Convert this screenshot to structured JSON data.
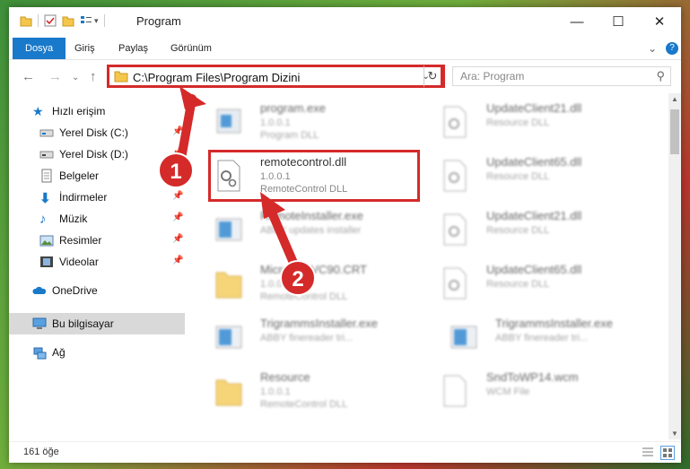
{
  "window": {
    "title": "Program",
    "minimize_icon": "minimize-icon",
    "maximize_icon": "maximize-icon",
    "close_icon": "close-icon"
  },
  "ribbon": {
    "tabs": [
      {
        "label": "Dosya",
        "active": true
      },
      {
        "label": "Giriş"
      },
      {
        "label": "Paylaş"
      },
      {
        "label": "Görünüm"
      }
    ],
    "help_icon": "help-icon"
  },
  "address_bar": {
    "path": "C:\\Program Files\\Program Dizini",
    "refresh_icon": "refresh-icon"
  },
  "search": {
    "placeholder": "Ara: Program"
  },
  "nav_pane": {
    "items": [
      {
        "label": "Hızlı erişim",
        "icon": "star-icon"
      },
      {
        "label": "Yerel Disk (C:)",
        "icon": "drive-icon",
        "pinned": true
      },
      {
        "label": "Yerel Disk (D:)",
        "icon": "drive-icon",
        "pinned": true
      },
      {
        "label": "Belgeler",
        "icon": "documents-icon",
        "pinned": true
      },
      {
        "label": "İndirmeler",
        "icon": "downloads-icon",
        "pinned": true
      },
      {
        "label": "Müzik",
        "icon": "music-icon",
        "pinned": true
      },
      {
        "label": "Resimler",
        "icon": "pictures-icon",
        "pinned": true
      },
      {
        "label": "Videolar",
        "icon": "videos-icon",
        "pinned": true
      },
      {
        "label": "OneDrive",
        "icon": "cloud-icon"
      },
      {
        "label": "Bu bilgisayar",
        "icon": "computer-icon",
        "selected": true
      },
      {
        "label": "Ağ",
        "icon": "network-icon"
      }
    ]
  },
  "files": [
    {
      "name": "program.exe",
      "line1": "1.0.0.1",
      "line2": "Program DLL"
    },
    {
      "name": "UpdateClient21.dll",
      "line1": "Resource DLL",
      "line2": ""
    },
    {
      "name": "remotecontrol.dll",
      "line1": "1.0.0.1",
      "line2": "RemoteControl DLL"
    },
    {
      "name": "UpdateClient65.dll",
      "line1": "Resource DLL",
      "line2": ""
    },
    {
      "name": "RemoteInstaller.exe",
      "line1": "ABBY updates installer",
      "line2": ""
    },
    {
      "name": "UpdateClient21.dll",
      "line1": "Resource DLL",
      "line2": ""
    },
    {
      "name": "Microsoft.VC90.CRT",
      "line1": "1.0.0.1",
      "line2": "RemoteControl DLL"
    },
    {
      "name": "UpdateClient65.dll",
      "line1": "Resource DLL",
      "line2": ""
    },
    {
      "name": "TrigrammsInstaller.exe",
      "line1": "ABBY finereader tri...",
      "line2": ""
    },
    {
      "name": "TrigrammsInstaller.exe",
      "line1": "ABBY finereader tri...",
      "line2": ""
    },
    {
      "name": "Resource",
      "line1": "1.0.0.1",
      "line2": "RemoteControl DLL"
    },
    {
      "name": "SndToWP14.wcm",
      "line1": "WCM File",
      "line2": ""
    }
  ],
  "annotations": {
    "badge1": "1",
    "badge2": "2"
  },
  "status": {
    "count": "161 öğe"
  },
  "colors": {
    "accent": "#1979ca",
    "highlight": "#d42a2a"
  }
}
